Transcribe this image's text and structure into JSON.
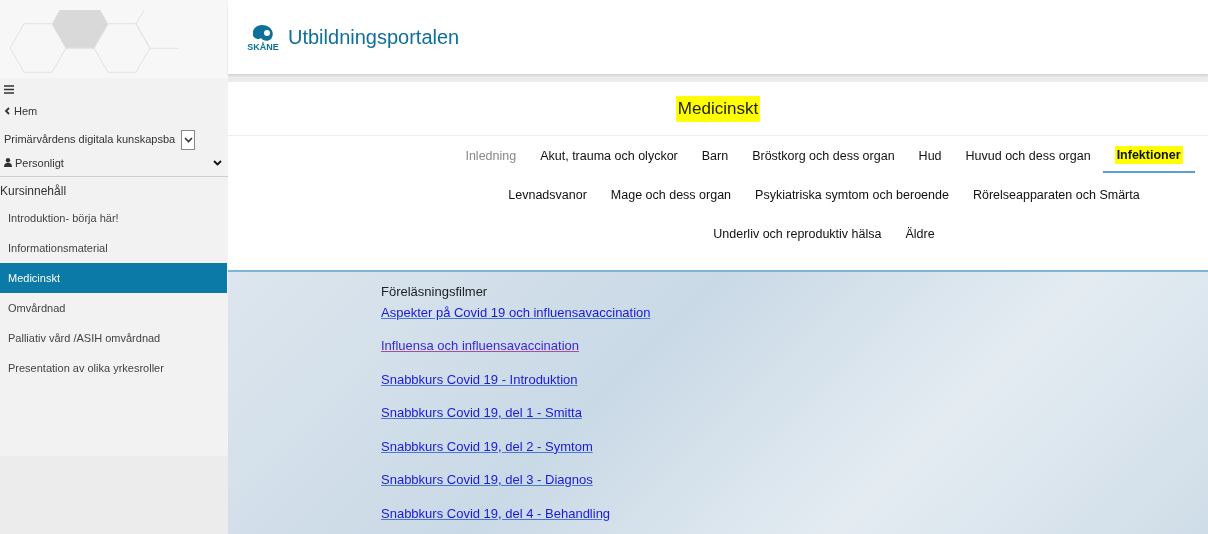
{
  "header": {
    "logo_text": "SKÅNE",
    "title": "Utbildningsportalen"
  },
  "sidebar": {
    "back": "Hem",
    "course_select": {
      "value": "Primärvårdens digitala kunskapsba"
    },
    "personal": "Personligt",
    "section_title": "Kursinnehåll",
    "items": [
      {
        "label": "Introduktion- börja här!",
        "selected": false
      },
      {
        "label": "Informationsmaterial",
        "selected": false
      },
      {
        "label": "Medicinskt",
        "selected": true
      },
      {
        "label": "Omvårdnad",
        "selected": false
      },
      {
        "label": "Palliativ vård /ASIH omvårdnad",
        "selected": false
      },
      {
        "label": "Presentation av olika yrkesroller",
        "selected": false
      }
    ]
  },
  "page": {
    "title": "Medicinskt",
    "title_highlighted": true,
    "tab_rows": [
      [
        {
          "label": "Inledning",
          "selected": false,
          "dimmed": true
        },
        {
          "label": "Akut, trauma och olyckor",
          "selected": false,
          "dimmed": false
        },
        {
          "label": "Barn",
          "selected": false,
          "dimmed": false
        },
        {
          "label": "Bröstkorg och dess organ",
          "selected": false,
          "dimmed": false
        },
        {
          "label": "Hud",
          "selected": false,
          "dimmed": false
        },
        {
          "label": "Huvud och dess organ",
          "selected": false,
          "dimmed": false
        },
        {
          "label": "Infektioner",
          "selected": true,
          "dimmed": false
        }
      ],
      [
        {
          "label": "Levnadsvanor",
          "selected": false,
          "dimmed": false
        },
        {
          "label": "Mage och dess organ",
          "selected": false,
          "dimmed": false
        },
        {
          "label": "Psykiatriska symtom och beroende",
          "selected": false,
          "dimmed": false
        },
        {
          "label": "Rörelseapparaten och Smärta",
          "selected": false,
          "dimmed": false
        }
      ],
      [
        {
          "label": "Underliv och reproduktiv hälsa",
          "selected": false,
          "dimmed": false
        },
        {
          "label": "Äldre",
          "selected": false,
          "dimmed": false
        }
      ]
    ],
    "content": {
      "heading": "Föreläsningsfilmer",
      "links": [
        {
          "label": "Aspekter på Covid 19 och influensavaccination",
          "visited": false
        },
        {
          "label": "Influensa och influensavaccination",
          "visited": true
        },
        {
          "label": "Snabbkurs Covid 19 - Introduktion",
          "visited": false
        },
        {
          "label": "Snabbkurs Covid 19, del 1 - Smitta",
          "visited": false
        },
        {
          "label": "Snabbkurs Covid 19, del 2 - Symtom",
          "visited": false
        },
        {
          "label": "Snabbkurs Covid 19, del 3 - Diagnos",
          "visited": false
        },
        {
          "label": "Snabbkurs Covid 19, del 4 - Behandling",
          "visited": false
        }
      ]
    }
  }
}
